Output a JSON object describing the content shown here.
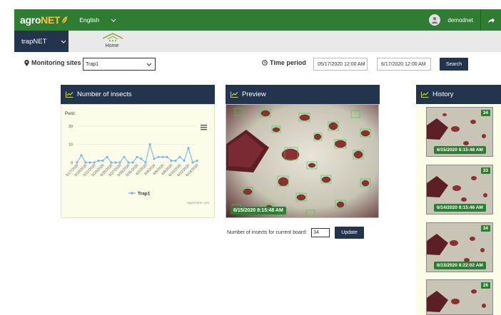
{
  "app": {
    "logo_main": "agro",
    "logo_accent": "NET",
    "language": "English",
    "username": "demodnet",
    "module": "trapNET",
    "home_label": "Home"
  },
  "filters": {
    "sites_label": "Monitoring sites",
    "site_value": "Trap1",
    "time_label": "Time period",
    "date_from": "05/17/2020 12:00 AM",
    "date_to": "6/17/2020 12:00 AM",
    "search_label": "Search"
  },
  "insects_panel": {
    "title": "Number of insects"
  },
  "preview_panel": {
    "title": "Preview",
    "timestamp": "6/15/2020 8:15:48 AM",
    "update_prompt": "Number of insects for current board:",
    "count_value": "34",
    "update_label": "Update"
  },
  "history_panel": {
    "title": "History",
    "items": [
      {
        "count": "34",
        "timestamp": "6/15/2020 8:15:48 AM"
      },
      {
        "count": "33",
        "timestamp": "6/14/2020 8:15:46 AM"
      },
      {
        "count": "34",
        "timestamp": "6/13/2020 8:22:02 AM"
      },
      {
        "count": "26",
        "timestamp": ""
      }
    ]
  },
  "chart_data": {
    "type": "line",
    "title": "Pest:",
    "credits": "Highcharts.com",
    "ylim": [
      0,
      20
    ],
    "yticks": [
      0,
      10,
      20
    ],
    "x_tick_labels": [
      "5/17/2020",
      "5/19/2020",
      "5/21/2020",
      "5/23/2020",
      "5/25/2020",
      "5/27/2020",
      "5/29/2020",
      "5/31/2020",
      "6/2/2020",
      "6/4/2020",
      "6/6/2020",
      "6/8/2020",
      "6/10/2020",
      "6/12/2020",
      "6/14/2020",
      "6/16/2020"
    ],
    "series": [
      {
        "name": "Trap1",
        "color": "#7cb5ec",
        "values": [
          0,
          4,
          0,
          0,
          0,
          1,
          1,
          3,
          0,
          0,
          0,
          3,
          0,
          0,
          3,
          2,
          0,
          10,
          2,
          3,
          3,
          3,
          1,
          1,
          3,
          1,
          8,
          0,
          1
        ]
      }
    ],
    "grid": true,
    "legend_position": "bottom"
  }
}
